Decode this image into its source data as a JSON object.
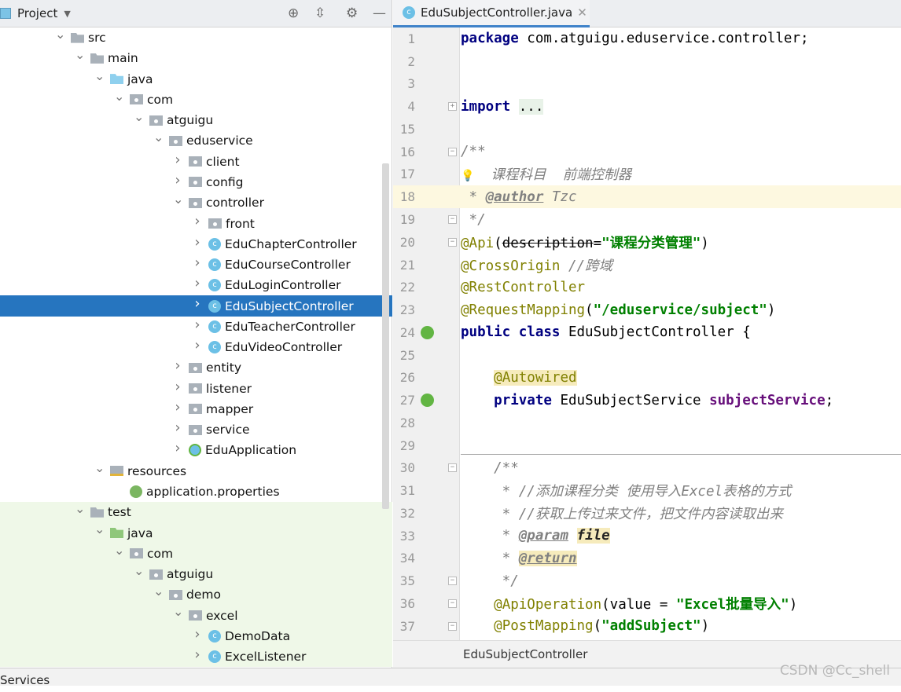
{
  "project": {
    "title": "Project",
    "tools": [
      "locate-icon",
      "collapse-icon",
      "gear-icon",
      "minimize-icon"
    ]
  },
  "tree": [
    {
      "label": "src",
      "level": 0,
      "icon": "folder",
      "open": true
    },
    {
      "label": "main",
      "level": 1,
      "icon": "folder",
      "open": true
    },
    {
      "label": "java",
      "level": 2,
      "icon": "src",
      "open": true
    },
    {
      "label": "com",
      "level": 3,
      "icon": "pkg",
      "open": true
    },
    {
      "label": "atguigu",
      "level": 4,
      "icon": "pkg",
      "open": true
    },
    {
      "label": "eduservice",
      "level": 5,
      "icon": "pkg",
      "open": true
    },
    {
      "label": "client",
      "level": 6,
      "icon": "pkg",
      "open": false
    },
    {
      "label": "config",
      "level": 6,
      "icon": "pkg",
      "open": false
    },
    {
      "label": "controller",
      "level": 6,
      "icon": "pkg",
      "open": true
    },
    {
      "label": "front",
      "level": 7,
      "icon": "pkg",
      "open": false
    },
    {
      "label": "EduChapterController",
      "level": 7,
      "icon": "cls",
      "open": false
    },
    {
      "label": "EduCourseController",
      "level": 7,
      "icon": "cls",
      "open": false
    },
    {
      "label": "EduLoginController",
      "level": 7,
      "icon": "cls",
      "open": false
    },
    {
      "label": "EduSubjectController",
      "level": 7,
      "icon": "cls",
      "open": false,
      "selected": true
    },
    {
      "label": "EduTeacherController",
      "level": 7,
      "icon": "cls",
      "open": false
    },
    {
      "label": "EduVideoController",
      "level": 7,
      "icon": "cls",
      "open": false
    },
    {
      "label": "entity",
      "level": 6,
      "icon": "pkg",
      "open": false
    },
    {
      "label": "listener",
      "level": 6,
      "icon": "pkg",
      "open": false
    },
    {
      "label": "mapper",
      "level": 6,
      "icon": "pkg",
      "open": false
    },
    {
      "label": "service",
      "level": 6,
      "icon": "pkg",
      "open": false
    },
    {
      "label": "EduApplication",
      "level": 6,
      "icon": "app",
      "open": false
    },
    {
      "label": "resources",
      "level": 2,
      "icon": "res",
      "open": true
    },
    {
      "label": "application.properties",
      "level": 3,
      "icon": "prop",
      "leaf": true
    },
    {
      "label": "test",
      "level": 1,
      "icon": "folder",
      "open": true,
      "test": true
    },
    {
      "label": "java",
      "level": 2,
      "icon": "tsrc",
      "open": true,
      "test": true
    },
    {
      "label": "com",
      "level": 3,
      "icon": "pkg",
      "open": true,
      "test": true
    },
    {
      "label": "atguigu",
      "level": 4,
      "icon": "pkg",
      "open": true,
      "test": true
    },
    {
      "label": "demo",
      "level": 5,
      "icon": "pkg",
      "open": true,
      "test": true
    },
    {
      "label": "excel",
      "level": 6,
      "icon": "pkg",
      "open": true,
      "test": true
    },
    {
      "label": "DemoData",
      "level": 7,
      "icon": "cls",
      "open": false,
      "test": true
    },
    {
      "label": "ExcelListener",
      "level": 7,
      "icon": "cls",
      "open": false,
      "test": true
    }
  ],
  "editor": {
    "tab": "EduSubjectController.java",
    "breadcrumb": "EduSubjectController"
  },
  "code": [
    {
      "n": "1",
      "t": [
        [
          "package",
          "kw"
        ],
        [
          " com.atguigu.eduservice.controller;",
          ""
        ]
      ]
    },
    {
      "n": "2",
      "t": []
    },
    {
      "n": "3",
      "t": []
    },
    {
      "n": "4",
      "fold": "+",
      "t": [
        [
          "import",
          "kw"
        ],
        [
          " ",
          ""
        ],
        [
          "...",
          "fold-g"
        ]
      ]
    },
    {
      "n": "15",
      "t": []
    },
    {
      "n": "16",
      "fold": "-",
      "t": [
        [
          "/**",
          "cm"
        ]
      ]
    },
    {
      "n": "17",
      "t": [
        [
          "  ",
          ""
        ],
        [
          "课程科目  前端控制器",
          "cm"
        ]
      ],
      "bulb": true
    },
    {
      "n": "18",
      "hl": true,
      "t": [
        [
          " * ",
          "cm"
        ],
        [
          "@author",
          "tag"
        ],
        [
          " Tzc",
          "cm"
        ]
      ]
    },
    {
      "n": "19",
      "fold": "e",
      "t": [
        [
          " */",
          "cm"
        ]
      ]
    },
    {
      "n": "20",
      "fold": "-",
      "t": [
        [
          "@Api",
          "an"
        ],
        [
          "(",
          ""
        ],
        [
          "description",
          "strk"
        ],
        [
          "=",
          ""
        ],
        [
          "\"课程分类管理\"",
          "st"
        ],
        [
          ")",
          ""
        ]
      ]
    },
    {
      "n": "21",
      "t": [
        [
          "@CrossOrigin",
          "an"
        ],
        [
          " ",
          ""
        ],
        [
          "//跨域",
          "cm"
        ]
      ]
    },
    {
      "n": "22",
      "t": [
        [
          "@RestController",
          "an"
        ]
      ]
    },
    {
      "n": "23",
      "t": [
        [
          "@RequestMapping",
          "an"
        ],
        [
          "(",
          ""
        ],
        [
          "\"/eduservice/subject\"",
          "st"
        ],
        [
          ")",
          ""
        ]
      ]
    },
    {
      "n": "24",
      "gicon": true,
      "t": [
        [
          "public class",
          "kw"
        ],
        [
          " EduSubjectController {",
          ""
        ]
      ]
    },
    {
      "n": "25",
      "t": []
    },
    {
      "n": "26",
      "t": [
        [
          "    ",
          ""
        ],
        [
          "@Autowired",
          "an yel"
        ]
      ]
    },
    {
      "n": "27",
      "gicon": true,
      "t": [
        [
          "    ",
          ""
        ],
        [
          "private",
          "kw"
        ],
        [
          " EduSubjectService ",
          ""
        ],
        [
          "subjectService",
          "fld"
        ],
        [
          ";",
          ""
        ]
      ]
    },
    {
      "n": "28",
      "t": []
    },
    {
      "n": "29",
      "t": []
    },
    {
      "n": "30",
      "fold": "-",
      "t": [
        [
          "    /**",
          "cm"
        ]
      ]
    },
    {
      "n": "31",
      "t": [
        [
          "     * //添加课程分类 使用导入Excel表格的方式",
          "cm"
        ]
      ]
    },
    {
      "n": "32",
      "t": [
        [
          "     * //获取上传过来文件，把文件内容读取出来",
          "cm"
        ]
      ]
    },
    {
      "n": "33",
      "t": [
        [
          "     * ",
          "cm"
        ],
        [
          "@param",
          "tag"
        ],
        [
          " ",
          ""
        ],
        [
          "file",
          "pm yel"
        ]
      ]
    },
    {
      "n": "34",
      "t": [
        [
          "     * ",
          "cm"
        ],
        [
          "@return",
          "tag yel"
        ]
      ]
    },
    {
      "n": "35",
      "fold": "e",
      "t": [
        [
          "     */",
          "cm"
        ]
      ]
    },
    {
      "n": "36",
      "fold": "-",
      "t": [
        [
          "    ",
          ""
        ],
        [
          "@ApiOperation",
          "an"
        ],
        [
          "(value = ",
          ""
        ],
        [
          "\"Excel批量导入\"",
          "st"
        ],
        [
          ")",
          ""
        ]
      ]
    },
    {
      "n": "37",
      "fold": "e",
      "t": [
        [
          "    ",
          ""
        ],
        [
          "@PostMapping",
          "an"
        ],
        [
          "(",
          ""
        ],
        [
          "\"addSubject\"",
          "st"
        ],
        [
          ")",
          ""
        ]
      ]
    }
  ],
  "bottom": {
    "services": "Services"
  },
  "watermark": "CSDN @Cc_shell"
}
